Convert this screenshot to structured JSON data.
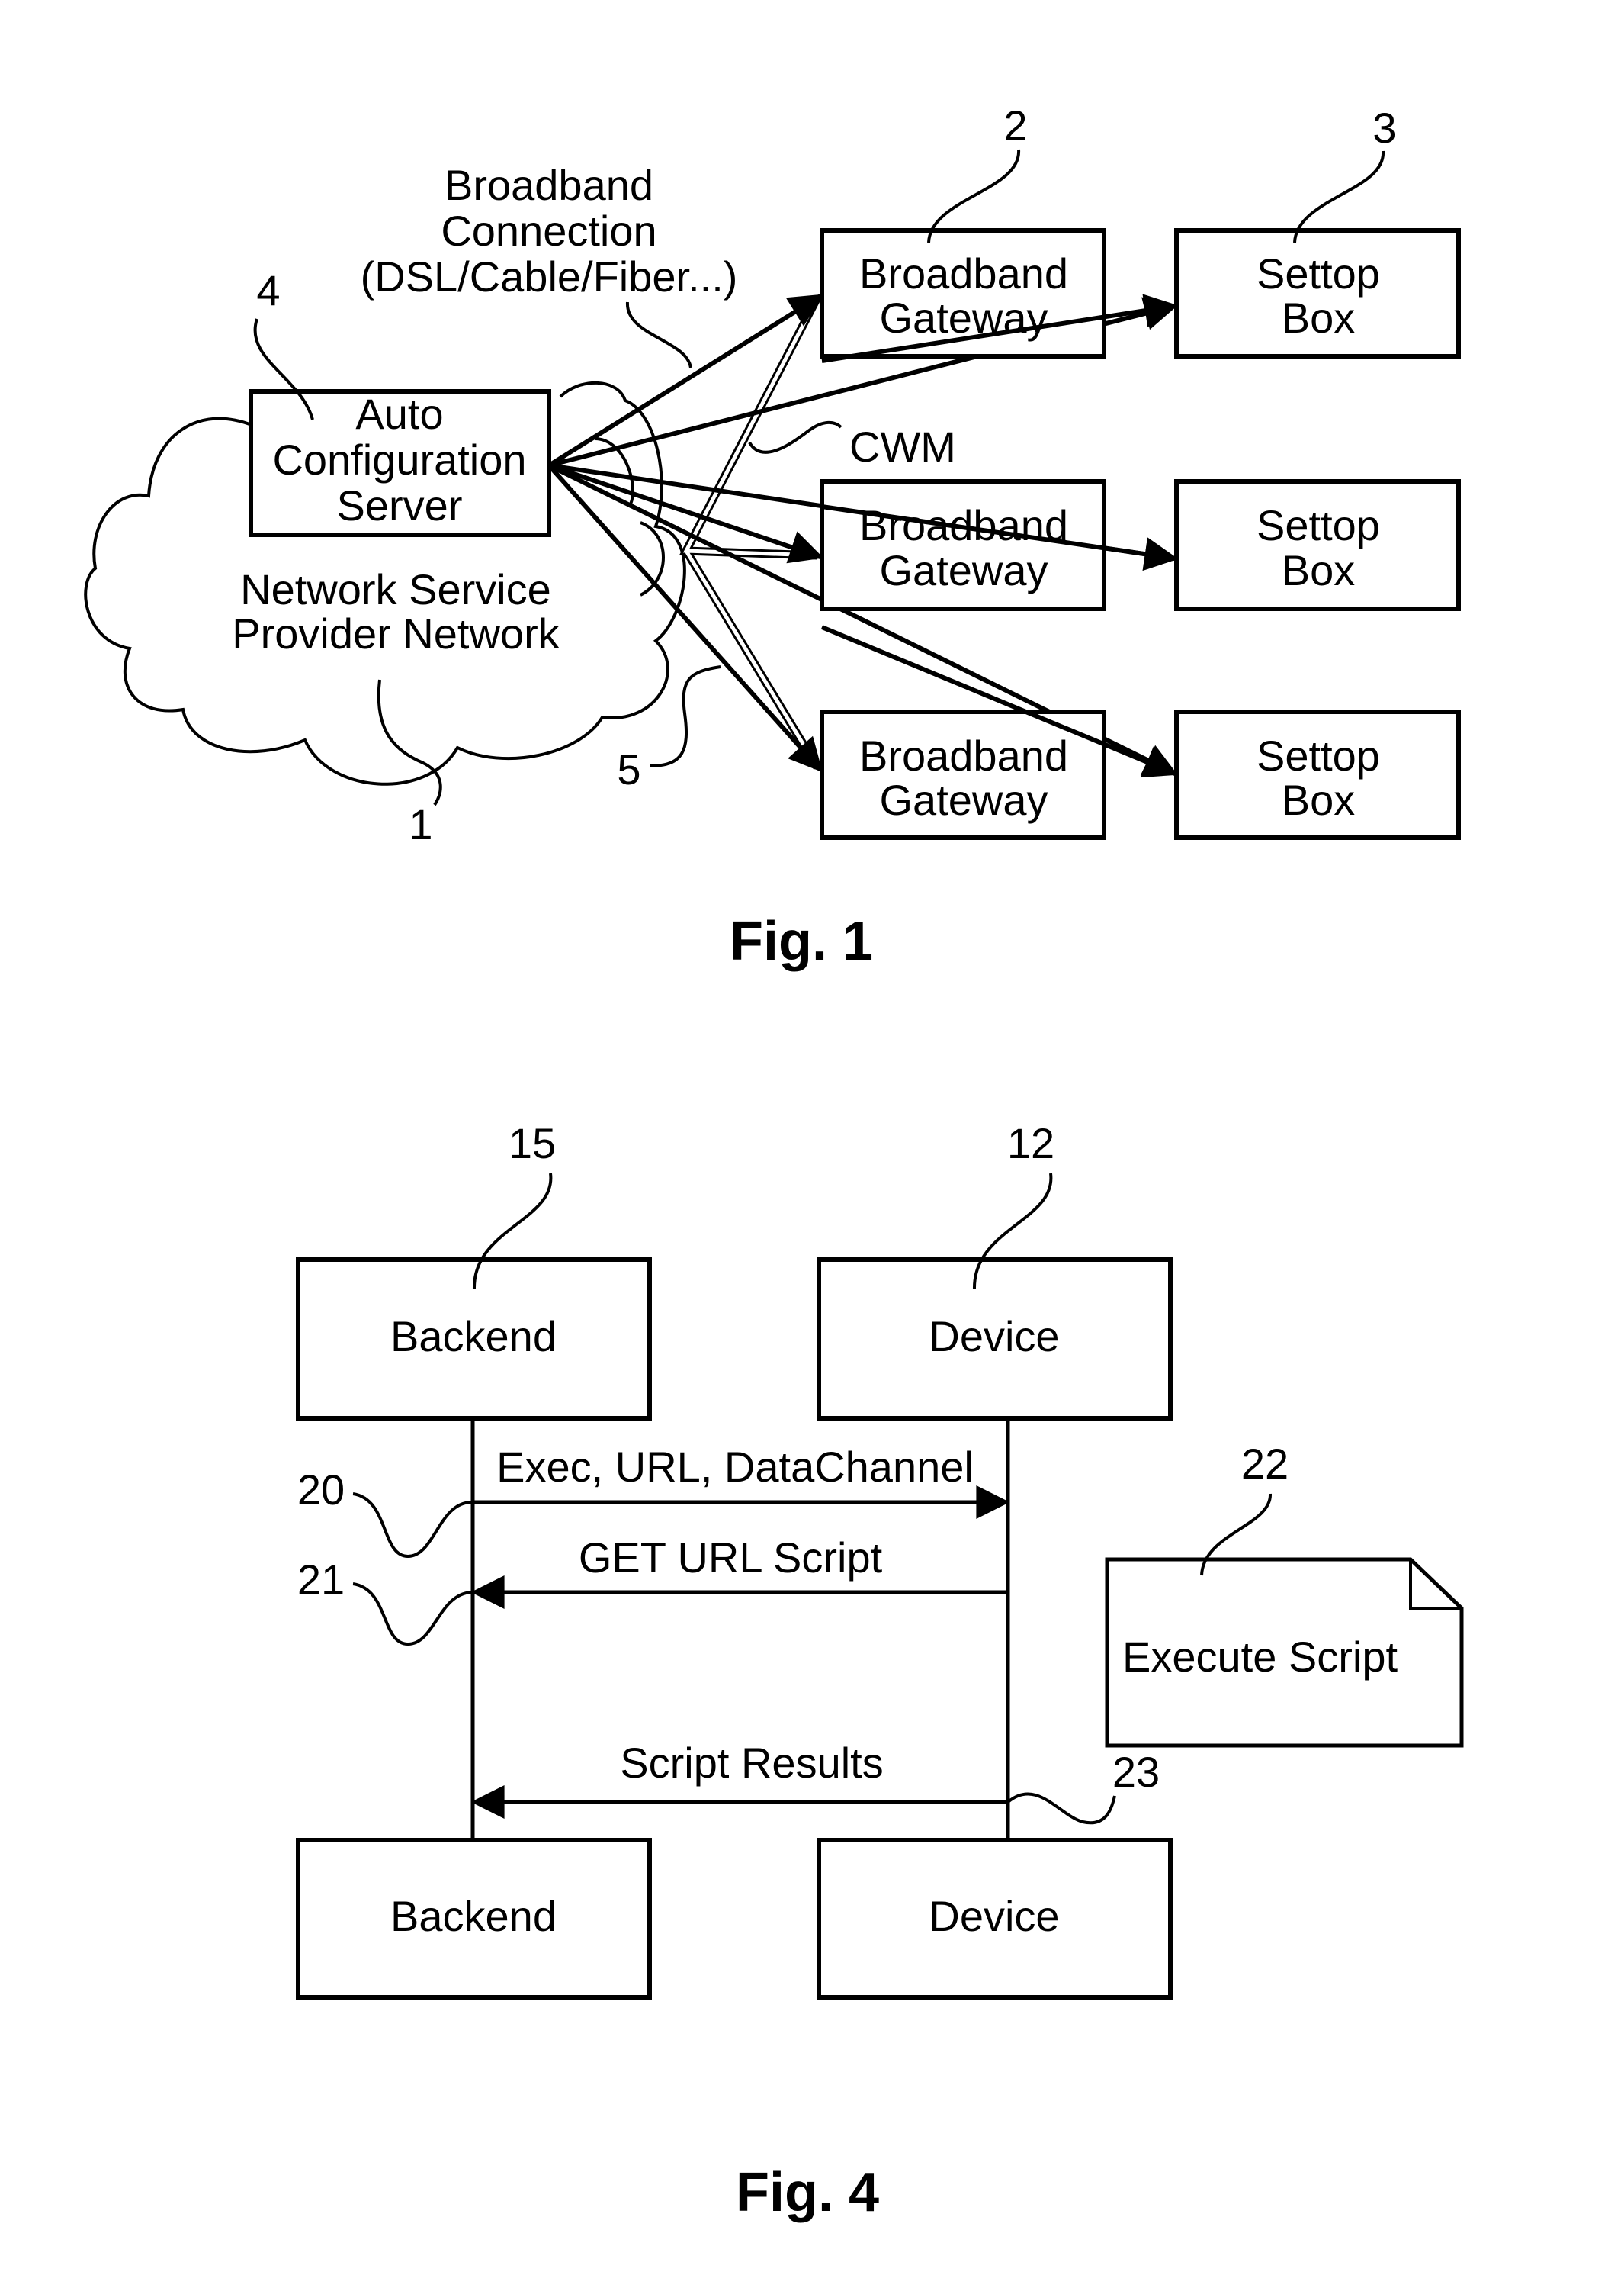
{
  "fig1": {
    "caption": "Fig. 1",
    "cloud": {
      "label_lines": [
        "Network Service",
        "Provider Network"
      ],
      "ref": "1"
    },
    "acs": {
      "label_lines": [
        "Auto",
        "Configuration",
        "Server"
      ],
      "ref": "4"
    },
    "connection_label_lines": [
      "Broadband",
      "Connection",
      "(DSL/Cable/Fiber...)"
    ],
    "cwm_label": "CWM",
    "link_ref": "5",
    "gateways": [
      {
        "label_lines": [
          "Broadband",
          "Gateway"
        ],
        "ref": "2"
      },
      {
        "label_lines": [
          "Broadband",
          "Gateway"
        ]
      },
      {
        "label_lines": [
          "Broadband",
          "Gateway"
        ]
      }
    ],
    "settop_boxes": [
      {
        "label_lines": [
          "Settop",
          "Box"
        ],
        "ref": "3"
      },
      {
        "label_lines": [
          "Settop",
          "Box"
        ]
      },
      {
        "label_lines": [
          "Settop",
          "Box"
        ]
      }
    ]
  },
  "fig4": {
    "caption": "Fig. 4",
    "backend": {
      "label": "Backend",
      "ref": "15"
    },
    "device": {
      "label": "Device",
      "ref": "12"
    },
    "messages": [
      {
        "label": "Exec, URL, DataChannel",
        "ref": "20",
        "direction": "backend-to-device"
      },
      {
        "label": "GET URL Script",
        "ref": "21",
        "direction": "device-to-backend"
      },
      {
        "label": "Script Results",
        "ref": "23",
        "direction": "device-to-backend"
      }
    ],
    "note": {
      "label": "Execute Script",
      "ref": "22"
    },
    "backend_bottom": {
      "label": "Backend"
    },
    "device_bottom": {
      "label": "Device"
    }
  }
}
